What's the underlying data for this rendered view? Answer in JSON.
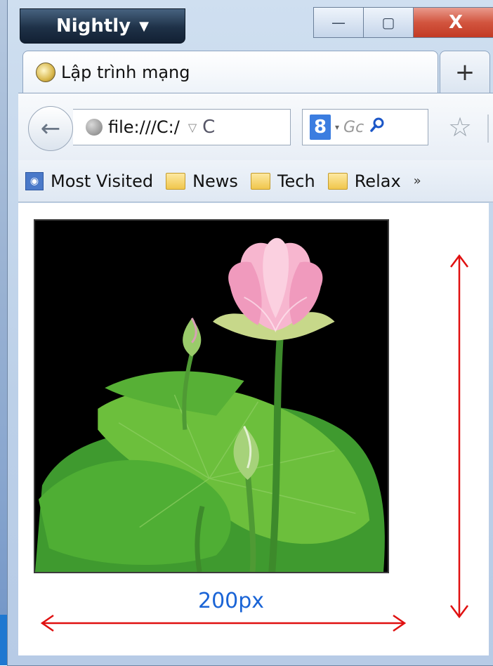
{
  "window": {
    "app_button": "Nightly",
    "controls": {
      "minimize": "—",
      "maximize": "▢",
      "close": "X"
    }
  },
  "tab": {
    "title": "Lập trình mạng",
    "new_tab": "+"
  },
  "navbar": {
    "back": "←",
    "url": "file:///C:/",
    "url_dropdown": "▽",
    "reload": "C",
    "search_engine": "8",
    "search_placeholder": "Gc",
    "search_button": "⚲",
    "bookmark_star": "☆"
  },
  "bookmarks": {
    "items": [
      {
        "label": "Most Visited",
        "icon": "most-visited-icon"
      },
      {
        "label": "News",
        "icon": "folder-icon"
      },
      {
        "label": "Tech",
        "icon": "folder-icon"
      },
      {
        "label": "Relax",
        "icon": "folder-icon"
      }
    ],
    "overflow": "»"
  },
  "content": {
    "image_subject": "lotus",
    "width_label": "200px",
    "annotation_color": "#e01010"
  }
}
